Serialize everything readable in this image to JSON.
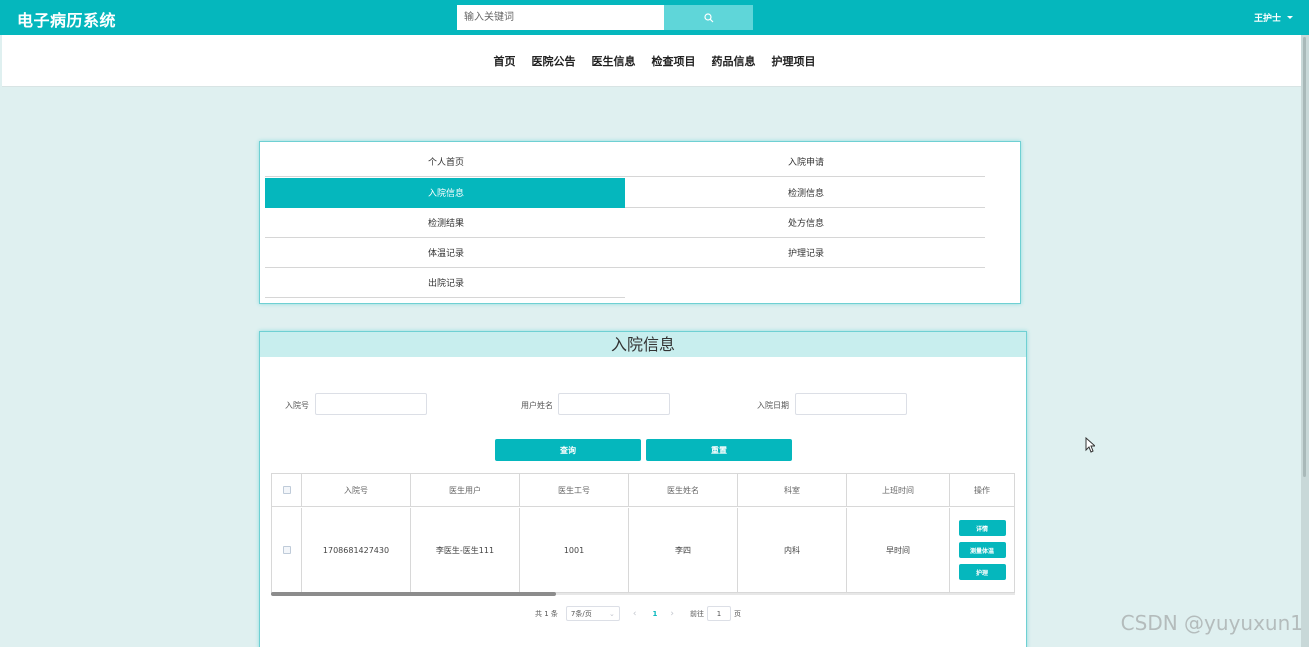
{
  "header": {
    "app_title": "电子病历系统",
    "search_placeholder": "输入关键词",
    "user_name": "王护士"
  },
  "nav": [
    "首页",
    "医院公告",
    "医生信息",
    "检查项目",
    "药品信息",
    "护理项目"
  ],
  "side_menu": {
    "active": "入院信息",
    "items": [
      "个人首页",
      "入院申请",
      "入院信息",
      "检测信息",
      "检测结果",
      "处方信息",
      "体温记录",
      "护理记录",
      "出院记录"
    ]
  },
  "panel": {
    "title": "入院信息",
    "filters": {
      "admission_no": "入院号",
      "user_name": "用户姓名",
      "admission_date": "入院日期"
    },
    "buttons": {
      "query": "查询",
      "reset": "重置"
    },
    "table": {
      "headers": [
        "入院号",
        "医生用户",
        "医生工号",
        "医生姓名",
        "科室",
        "上班时间",
        "操作"
      ],
      "rows": [
        {
          "cells": [
            "1708681427430",
            "李医生-医生111",
            "1001",
            "李四",
            "内科",
            "早时间"
          ],
          "actions": [
            "详情",
            "测量体温",
            "护理"
          ]
        }
      ]
    },
    "pagination": {
      "total": "共 1 条",
      "page_size": "7条/页",
      "current_page": "1",
      "goto_label": "前往",
      "goto_value": "1",
      "page_unit": "页"
    }
  },
  "watermark": "CSDN @yuyuxun1",
  "colors": {
    "primary": "#05b7bd",
    "background": "#dff0f0",
    "panel_header": "#c8eeee"
  }
}
